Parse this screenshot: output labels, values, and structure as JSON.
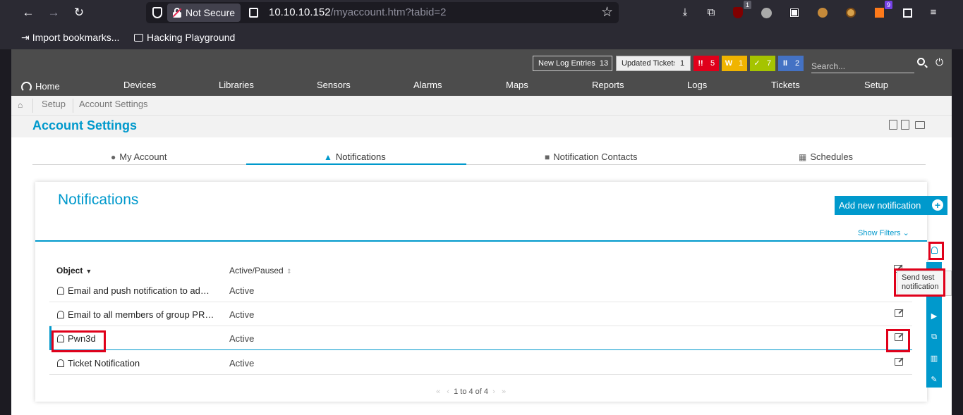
{
  "browser": {
    "url_host": "10.10.10.152",
    "url_path": "/myaccount.htm?tabid=2",
    "security_label": "Not Secure",
    "ext_badge_1": "1",
    "ext_badge_2": "9",
    "bookmarks": [
      {
        "label": "Import bookmarks..."
      },
      {
        "label": "Hacking Playground"
      }
    ]
  },
  "prtg": {
    "counters": {
      "log_label": "New Log Entries",
      "log_count": "13",
      "tickets_label": "Updated Tickets",
      "tickets_count": "1"
    },
    "status": [
      {
        "sym": "!!",
        "count": "5",
        "color": "#e0001a"
      },
      {
        "sym": "W",
        "count": "1",
        "color": "#f0b400"
      },
      {
        "sym": "✓",
        "count": "7",
        "color": "#a5c400"
      },
      {
        "sym": "II",
        "count": "2",
        "color": "#4472c4"
      }
    ],
    "search_placeholder": "Search...",
    "menu": [
      "Home",
      "Devices",
      "Libraries",
      "Sensors",
      "Alarms",
      "Maps",
      "Reports",
      "Logs",
      "Tickets",
      "Setup"
    ],
    "breadcrumb": [
      "Setup",
      "Account Settings"
    ],
    "page_title": "Account Settings",
    "tabs": [
      {
        "label": "My Account",
        "icon": "user-icon"
      },
      {
        "label": "Notifications",
        "icon": "bell-icon"
      },
      {
        "label": "Notification Contacts",
        "icon": "contact-icon"
      },
      {
        "label": "Schedules",
        "icon": "calendar-icon"
      }
    ],
    "notifications": {
      "title": "Notifications",
      "add_label": "Add new notification",
      "show_filters": "Show Filters ⌄",
      "col_object": "Object",
      "col_active": "Active/Paused",
      "rows": [
        {
          "name": "Email and push notification to ad…",
          "status": "Active"
        },
        {
          "name": "Email to all members of group PR…",
          "status": "Active"
        },
        {
          "name": "Pwn3d",
          "status": "Active"
        },
        {
          "name": "Ticket Notification",
          "status": "Active"
        }
      ],
      "pager": "1 to 4 of 4",
      "tooltip_line1": "Send test",
      "tooltip_line2": "notification"
    },
    "accent_color": "#0099cc"
  }
}
